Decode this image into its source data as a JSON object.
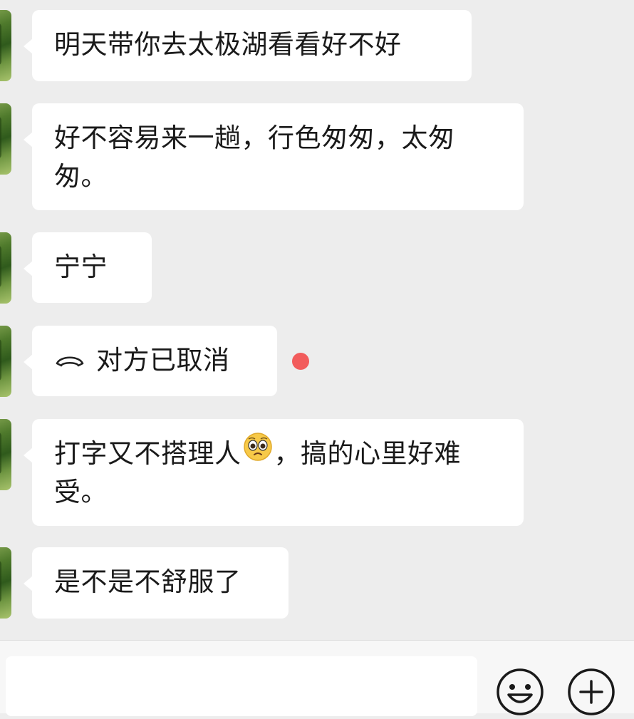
{
  "messages": [
    {
      "text": "明天带你去太极湖看看好不好"
    },
    {
      "text": "好不容易来一趟，行色匆匆，太匆匆。"
    },
    {
      "text": "宁宁"
    },
    {
      "text": "对方已取消",
      "type": "call",
      "icon": "hangup-phone-icon",
      "unread": true
    },
    {
      "text_before": "打字又不搭理人",
      "emoji": "pleading-face-emoji",
      "text_after": "，搞的心里好难受。"
    },
    {
      "text": "是不是不舒服了"
    }
  ],
  "input_bar": {
    "input_value": "",
    "emoji_button_icon": "smiley-face-icon",
    "more_button_icon": "plus-circle-icon"
  },
  "colors": {
    "background": "#ededed",
    "bubble": "#ffffff",
    "unread_dot": "#f25c5c"
  }
}
